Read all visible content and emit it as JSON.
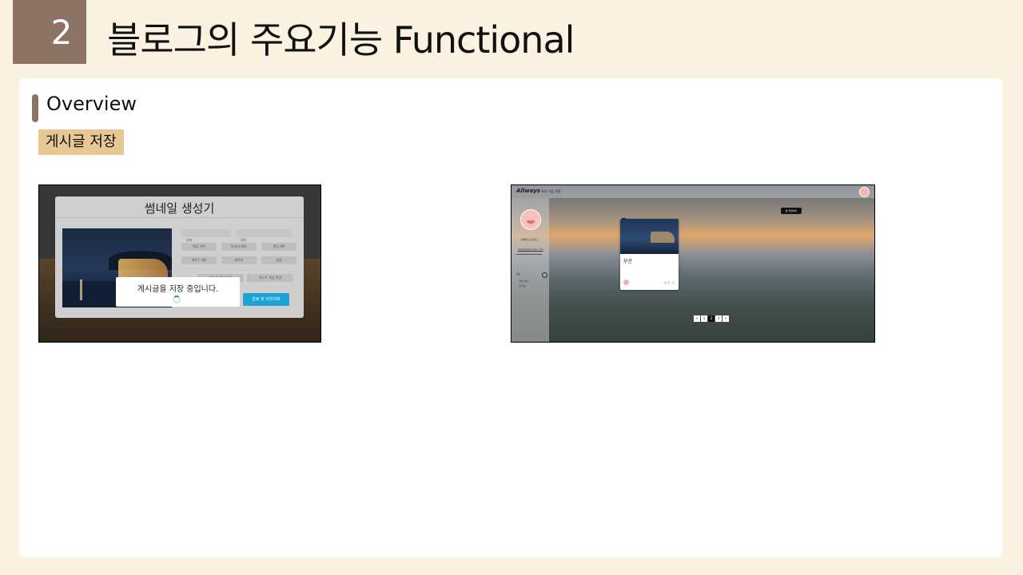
{
  "header": {
    "section_number": "2",
    "title": "블로그의 주요기능 Functional"
  },
  "panel": {
    "overview_title": "Overview",
    "feature_badge": "게시글 저장"
  },
  "thumbnail_generator": {
    "modal_title": "썸네일 생성기",
    "fields": [
      "날짜",
      "제목"
    ],
    "options": [
      "랜덤 선택",
      "이미지 URL",
      "랜덤 API",
      "제목 / 내용",
      "제목만",
      "없음",
      "텍스트 색상 변경",
      "텍스트 색상 변경"
    ],
    "done_button": "완료 및 이미지화",
    "toast_text": "게시글을 저장 중입니다."
  },
  "blog_main": {
    "logo": "Allways",
    "nav_text": "여러 사람 개발",
    "sidebar": {
      "blog_name": "에베레스트블로그",
      "link_text": "example@naver.com",
      "section": "메뉴",
      "items": [
        "전체 게시",
        "새 게시"
      ]
    },
    "write_button": "글 작성하기",
    "card": {
      "title": "부산",
      "meta": "3일 전 · 댓"
    },
    "pager": [
      "<",
      "1",
      "2",
      "3",
      ">"
    ],
    "pager_active_index": 2
  }
}
